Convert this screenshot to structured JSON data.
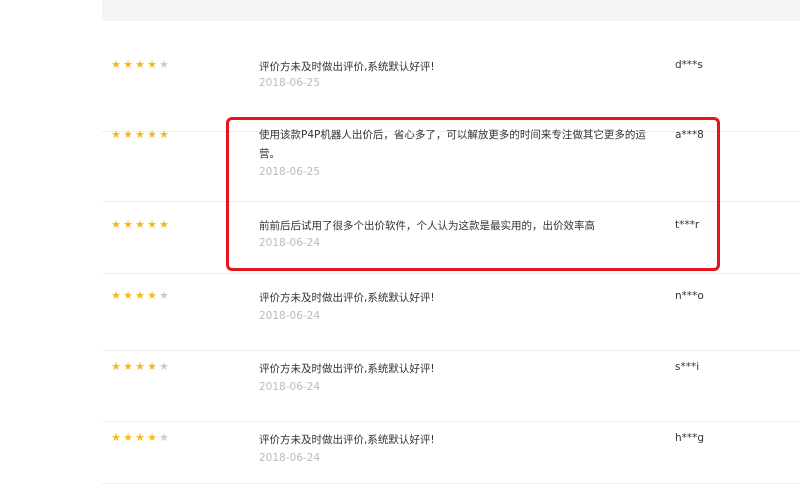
{
  "colors": {
    "star_on": "#f5b81f",
    "star_off": "#cccccc",
    "highlight": "#e8141c"
  },
  "reviews": [
    {
      "rating": 4,
      "comment": "评价方未及时做出评价,系统默认好评!",
      "date": "2018-06-25",
      "user": "d***s"
    },
    {
      "rating": 5,
      "comment": "使用该款P4P机器人出价后，省心多了，可以解放更多的时间来专注做其它更多的运营。",
      "date": "2018-06-25",
      "user": "a***8"
    },
    {
      "rating": 5,
      "comment": "前前后后试用了很多个出价软件，个人认为这款是最实用的，出价效率高",
      "date": "2018-06-24",
      "user": "t***r"
    },
    {
      "rating": 4,
      "comment": "评价方未及时做出评价,系统默认好评!",
      "date": "2018-06-24",
      "user": "n***o"
    },
    {
      "rating": 4,
      "comment": "评价方未及时做出评价,系统默认好评!",
      "date": "2018-06-24",
      "user": "s***i"
    },
    {
      "rating": 4,
      "comment": "评价方未及时做出评价,系统默认好评!",
      "date": "2018-06-24",
      "user": "h***g"
    }
  ]
}
